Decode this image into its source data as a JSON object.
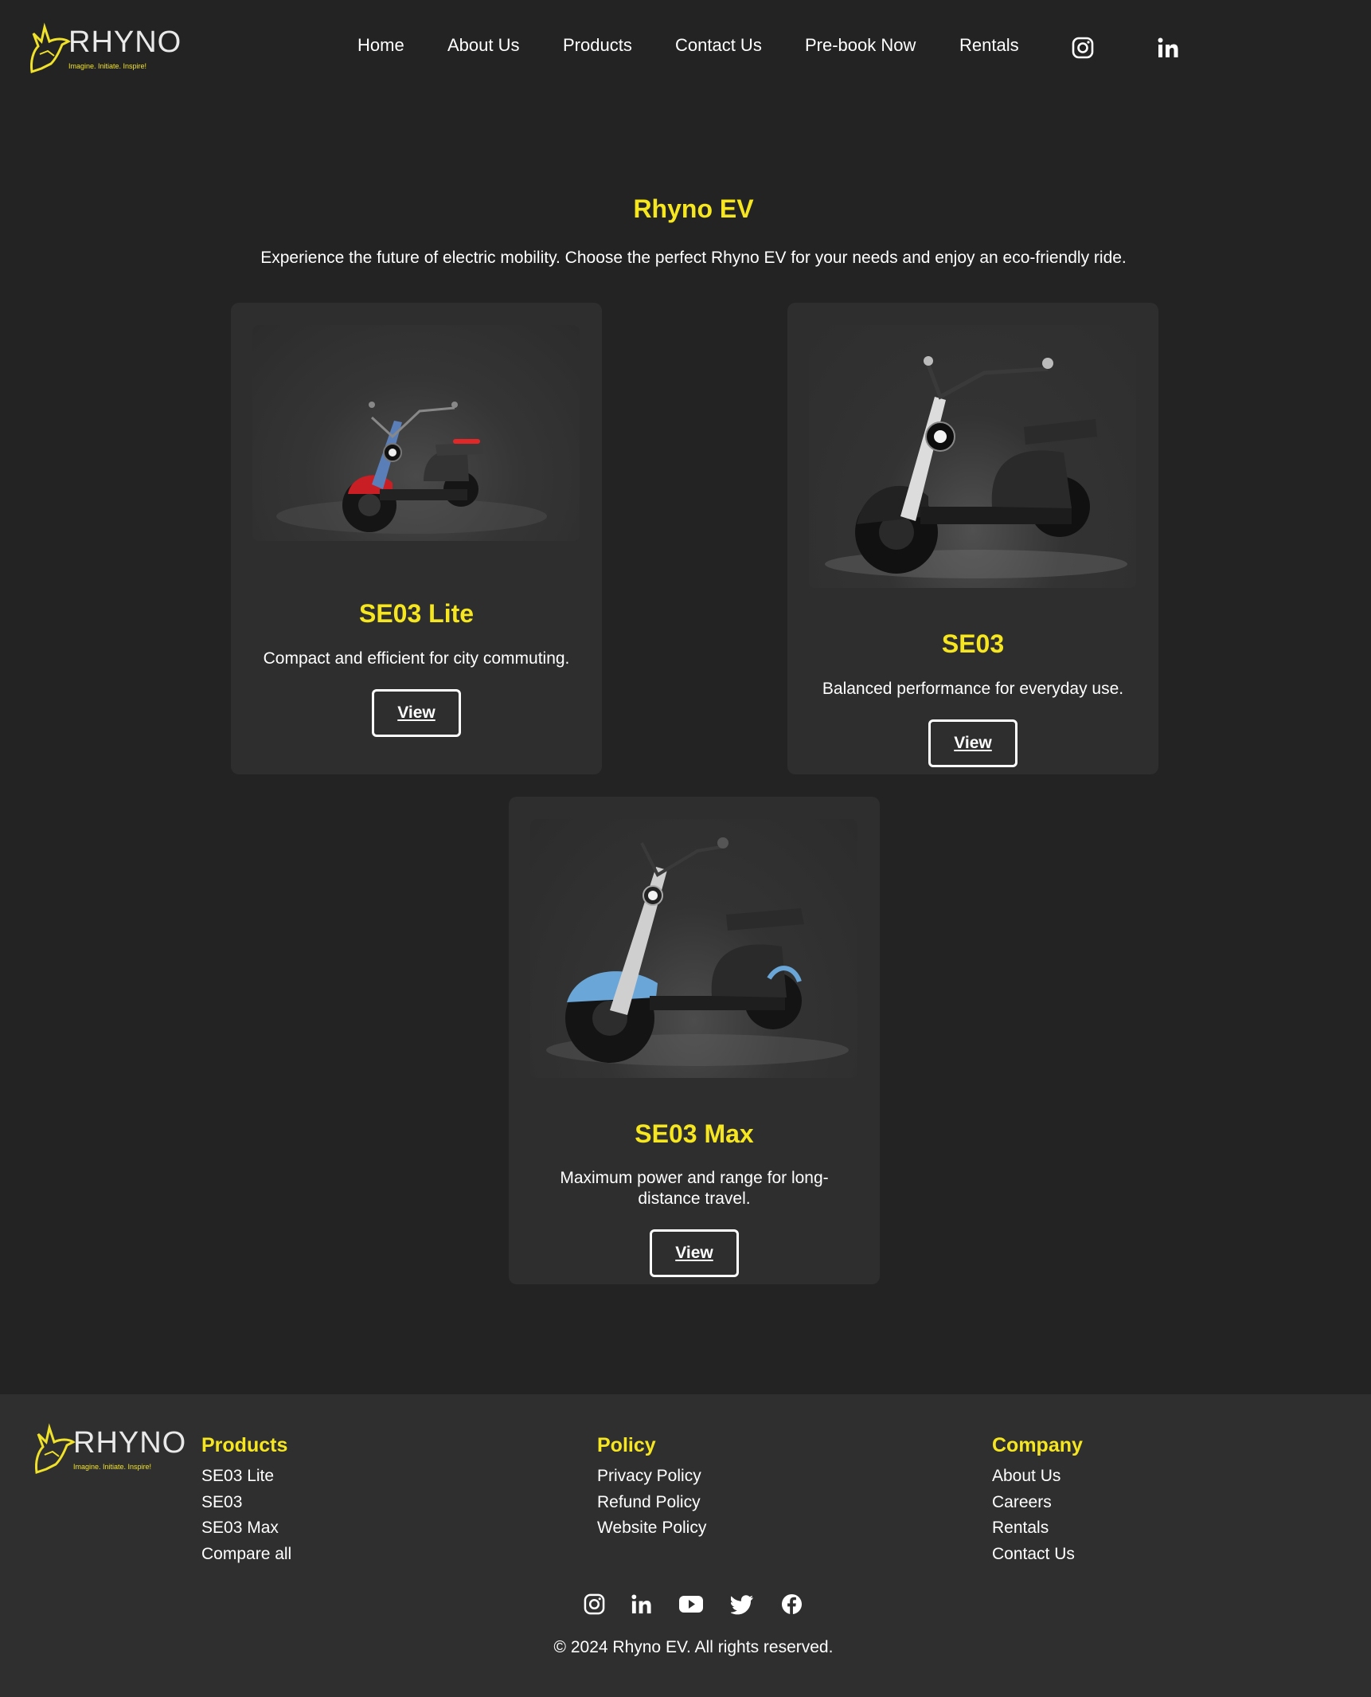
{
  "brand": {
    "name": "RHYNO",
    "tagline": "Imagine. Initiate. Inspire!"
  },
  "nav": {
    "items": [
      "Home",
      "About Us",
      "Products",
      "Contact Us",
      "Pre-book Now",
      "Rentals"
    ],
    "social_icons": [
      "instagram-icon",
      "linkedin-icon"
    ]
  },
  "hero": {
    "title": "Rhyno EV",
    "subtitle": "Experience the future of electric mobility. Choose the perfect Rhyno EV for your needs and enjoy an eco-friendly ride."
  },
  "products": [
    {
      "name": "SE03 Lite",
      "description": "Compact and efficient for city commuting.",
      "button": "View",
      "accent_color": "#c81e24"
    },
    {
      "name": "SE03",
      "description": "Balanced performance for everyday use.",
      "button": "View",
      "accent_color": "#1b1b1b"
    },
    {
      "name": "SE03 Max",
      "description": "Maximum power and range for long-distance travel.",
      "button": "View",
      "accent_color": "#6aa7d8"
    }
  ],
  "footer": {
    "columns": [
      {
        "heading": "Products",
        "links": [
          "SE03 Lite",
          "SE03",
          "SE03 Max",
          "Compare all"
        ]
      },
      {
        "heading": "Policy",
        "links": [
          "Privacy Policy",
          "Refund Policy",
          "Website Policy"
        ]
      },
      {
        "heading": "Company",
        "links": [
          "About Us",
          "Careers",
          "Rentals",
          "Contact Us"
        ]
      }
    ],
    "social_icons": [
      "instagram-icon",
      "linkedin-icon",
      "youtube-icon",
      "twitter-icon",
      "facebook-icon"
    ],
    "copyright": "© 2024 Rhyno EV. All rights reserved."
  },
  "colors": {
    "background": "#232323",
    "card": "#2e2e2e",
    "footer": "#2f2f2f",
    "accent": "#f6e620",
    "text": "#ffffff"
  }
}
